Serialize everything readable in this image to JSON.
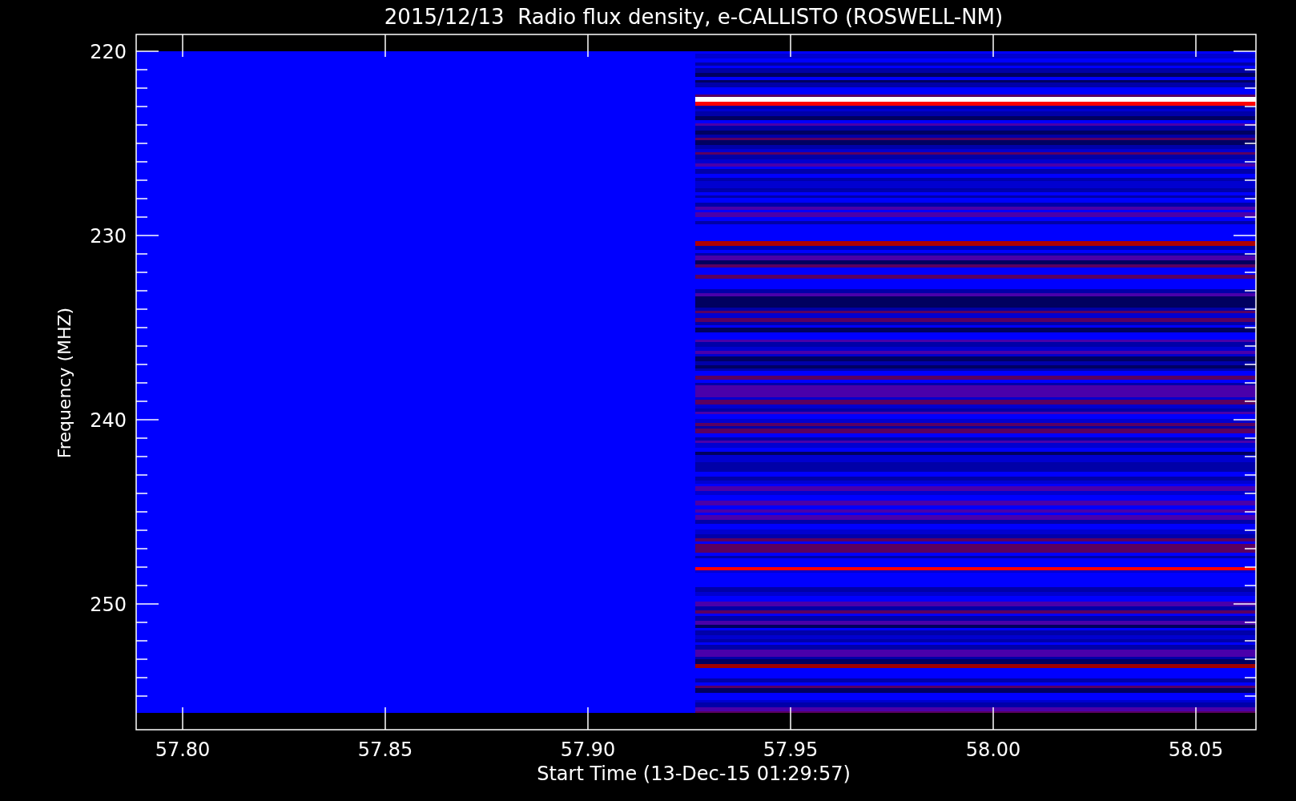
{
  "title": "2015/12/13  Radio flux density, e-CALLISTO (ROSWELL-NM)",
  "y_axis": {
    "label": "Frequency (MHZ)",
    "ticks": [
      "220",
      "230",
      "240",
      "250"
    ]
  },
  "x_axis": {
    "label": "Start Time (13-Dec-15 01:29:57)",
    "ticks": [
      "57.80",
      "57.85",
      "57.90",
      "57.95",
      "58.00",
      "58.05"
    ]
  }
}
